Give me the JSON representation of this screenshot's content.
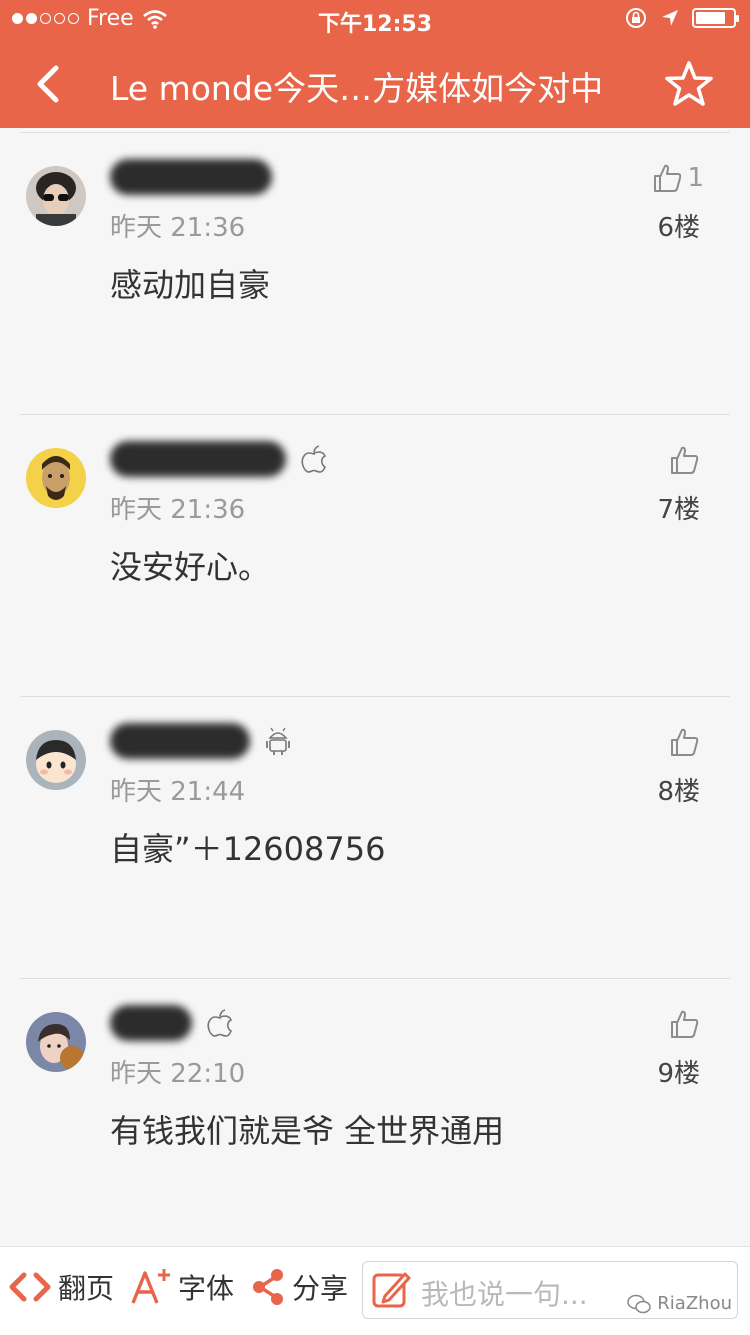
{
  "status_bar": {
    "carrier": "Free",
    "time": "下午12:53",
    "signal_bars_filled": 2,
    "signal_bars_total": 5,
    "battery_level": 0.8,
    "icons": [
      "wifi-icon",
      "rotation-lock-icon",
      "location-arrow-icon",
      "battery-icon"
    ]
  },
  "nav": {
    "title": "Le monde今天…方媒体如今对中",
    "back_icon": "chevron-left-icon",
    "favorite_icon": "star-outline-icon"
  },
  "comments": [
    {
      "time": "昨天 21:36",
      "text": "感动加自豪",
      "likes": "1",
      "floor": "6楼",
      "platform_icon": ""
    },
    {
      "time": "昨天 21:36",
      "text": "没安好心。",
      "likes": "",
      "floor": "7楼",
      "platform_icon": "apple-icon"
    },
    {
      "time": "昨天 21:44",
      "text": "自豪”＋12608756",
      "likes": "",
      "floor": "8楼",
      "platform_icon": "android-icon"
    },
    {
      "time": "昨天 22:10",
      "text": "有钱我们就是爷 全世界通用",
      "likes": "",
      "floor": "9楼",
      "platform_icon": "apple-icon"
    }
  ],
  "toolbar": {
    "page_label": "翻页",
    "font_label": "字体",
    "share_label": "分享",
    "comment_placeholder": "我也说一句..."
  },
  "watermark": "RiaZhou",
  "colors": {
    "accent": "#e8654a",
    "background": "#f6f6f6"
  }
}
